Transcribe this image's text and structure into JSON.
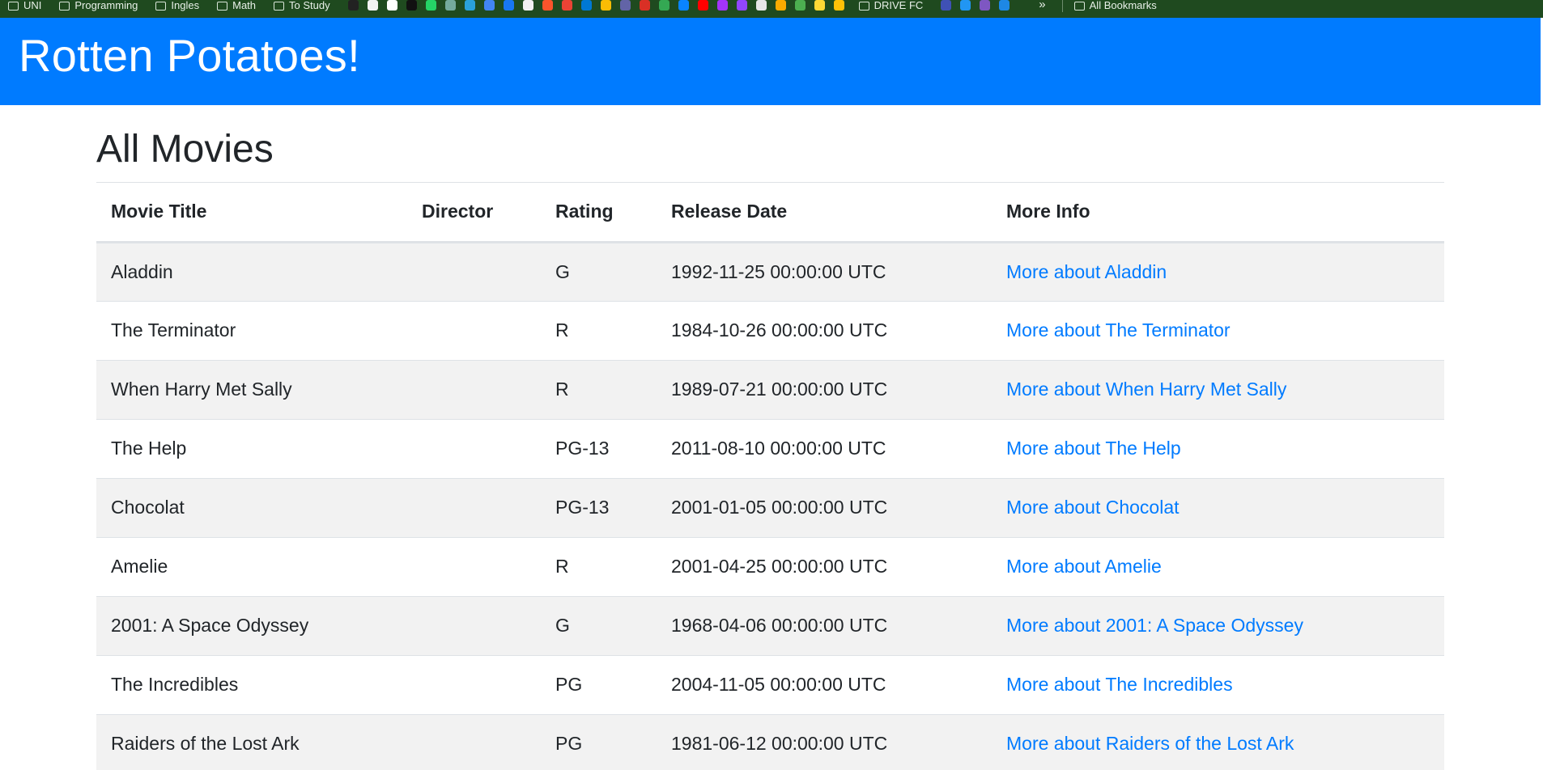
{
  "bookmarks": {
    "folders_left": [
      "UNI",
      "Programming",
      "Ingles",
      "Math",
      "To Study"
    ],
    "icons": [
      {
        "name": "site-icon",
        "color": "#222222"
      },
      {
        "name": "site-icon",
        "color": "#f3f3f3"
      },
      {
        "name": "site-icon",
        "color": "#ffffff"
      },
      {
        "name": "site-icon",
        "color": "#111111"
      },
      {
        "name": "whatsapp-icon",
        "color": "#25d366"
      },
      {
        "name": "chatgpt-icon",
        "color": "#74aa9c"
      },
      {
        "name": "telegram-icon",
        "color": "#2aa1da"
      },
      {
        "name": "translate-icon",
        "color": "#4285f4"
      },
      {
        "name": "facebook-icon",
        "color": "#1877f2"
      },
      {
        "name": "github-icon",
        "color": "#f0f0f0"
      },
      {
        "name": "brave-icon",
        "color": "#fb542b"
      },
      {
        "name": "gmail-icon",
        "color": "#ea4335"
      },
      {
        "name": "outlook-icon",
        "color": "#0078d4"
      },
      {
        "name": "drive-icon",
        "color": "#fbbc04"
      },
      {
        "name": "teams-icon",
        "color": "#6264a7"
      },
      {
        "name": "site-icon",
        "color": "#d93025"
      },
      {
        "name": "drive-icon",
        "color": "#34a853"
      },
      {
        "name": "onedrive-icon",
        "color": "#0a84ff"
      },
      {
        "name": "youtube-icon",
        "color": "#ff0000"
      },
      {
        "name": "messenger-icon",
        "color": "#a334fa"
      },
      {
        "name": "twitch-icon",
        "color": "#9146ff"
      },
      {
        "name": "site-icon",
        "color": "#e6e6e6"
      },
      {
        "name": "analytics-icon",
        "color": "#f9ab00"
      },
      {
        "name": "site-icon",
        "color": "#4caf50"
      },
      {
        "name": "site-icon",
        "color": "#fdd835"
      },
      {
        "name": "timer-icon",
        "color": "#ffc107"
      }
    ],
    "folders_middle": [
      "DRIVE FC"
    ],
    "icons_right": [
      {
        "name": "site-icon",
        "color": "#3f51b5"
      },
      {
        "name": "site-icon",
        "color": "#2196f3"
      },
      {
        "name": "site-icon",
        "color": "#7e57c2"
      },
      {
        "name": "site-icon",
        "color": "#1e88e5"
      }
    ],
    "more": "»",
    "all_bookmarks": "All Bookmarks"
  },
  "header": {
    "title": "Rotten Potatoes!"
  },
  "main": {
    "title": "All Movies",
    "columns": [
      "Movie Title",
      "Director",
      "Rating",
      "Release Date",
      "More Info"
    ],
    "movies": [
      {
        "title": "Aladdin",
        "director": "",
        "rating": "G",
        "release_date": "1992-11-25 00:00:00 UTC",
        "more": "More about Aladdin"
      },
      {
        "title": "The Terminator",
        "director": "",
        "rating": "R",
        "release_date": "1984-10-26 00:00:00 UTC",
        "more": "More about The Terminator"
      },
      {
        "title": "When Harry Met Sally",
        "director": "",
        "rating": "R",
        "release_date": "1989-07-21 00:00:00 UTC",
        "more": "More about When Harry Met Sally"
      },
      {
        "title": "The Help",
        "director": "",
        "rating": "PG-13",
        "release_date": "2011-08-10 00:00:00 UTC",
        "more": "More about The Help"
      },
      {
        "title": "Chocolat",
        "director": "",
        "rating": "PG-13",
        "release_date": "2001-01-05 00:00:00 UTC",
        "more": "More about Chocolat"
      },
      {
        "title": "Amelie",
        "director": "",
        "rating": "R",
        "release_date": "2001-04-25 00:00:00 UTC",
        "more": "More about Amelie"
      },
      {
        "title": "2001: A Space Odyssey",
        "director": "",
        "rating": "G",
        "release_date": "1968-04-06 00:00:00 UTC",
        "more": "More about 2001: A Space Odyssey"
      },
      {
        "title": "The Incredibles",
        "director": "",
        "rating": "PG",
        "release_date": "2004-11-05 00:00:00 UTC",
        "more": "More about The Incredibles"
      },
      {
        "title": "Raiders of the Lost Ark",
        "director": "",
        "rating": "PG",
        "release_date": "1981-06-12 00:00:00 UTC",
        "more": "More about Raiders of the Lost Ark"
      }
    ]
  },
  "colors": {
    "header_bg": "#007bff",
    "link": "#007bff",
    "stripe": "#f2f2f2",
    "bookmarks_bg": "#1f4a1f"
  }
}
